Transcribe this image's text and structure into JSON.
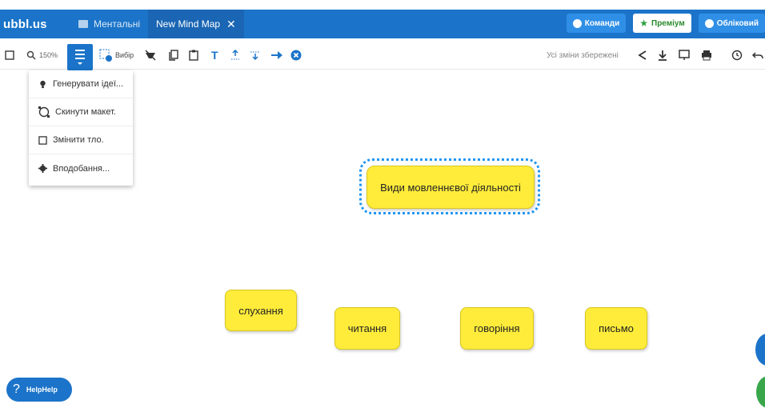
{
  "header": {
    "logo": "ubbl.us",
    "tabs": [
      {
        "label": "Ментальні",
        "icon": "folder-icon"
      },
      {
        "label": "New Mind Map",
        "close": "✕"
      }
    ],
    "buttons": {
      "team": "Команди",
      "premium": "Преміум",
      "account": "Обліковий"
    }
  },
  "toolbar": {
    "zoom_level": "150%",
    "select_label": "Вибір",
    "saved_status": "Усі зміни збережені"
  },
  "dropdown": {
    "items": [
      {
        "label": "Генерувати ідеї...",
        "icon": "lightbulb-icon"
      },
      {
        "label": "Скинути макет.",
        "icon": "layout-reset-icon"
      },
      {
        "label": "Змінити тло.",
        "icon": "square-icon"
      },
      {
        "label": "Вподобання...",
        "icon": "gear-icon"
      }
    ]
  },
  "mindmap": {
    "root": "Види мовленнєвої діяльності",
    "children": [
      "слухання",
      "читання",
      "говоріння",
      "письмо"
    ]
  },
  "help": {
    "label": "HelpHelp"
  },
  "colors": {
    "header": "#1b74c9",
    "node": "#ffec3a",
    "selection": "#2196f3",
    "premium": "#2ea043"
  }
}
